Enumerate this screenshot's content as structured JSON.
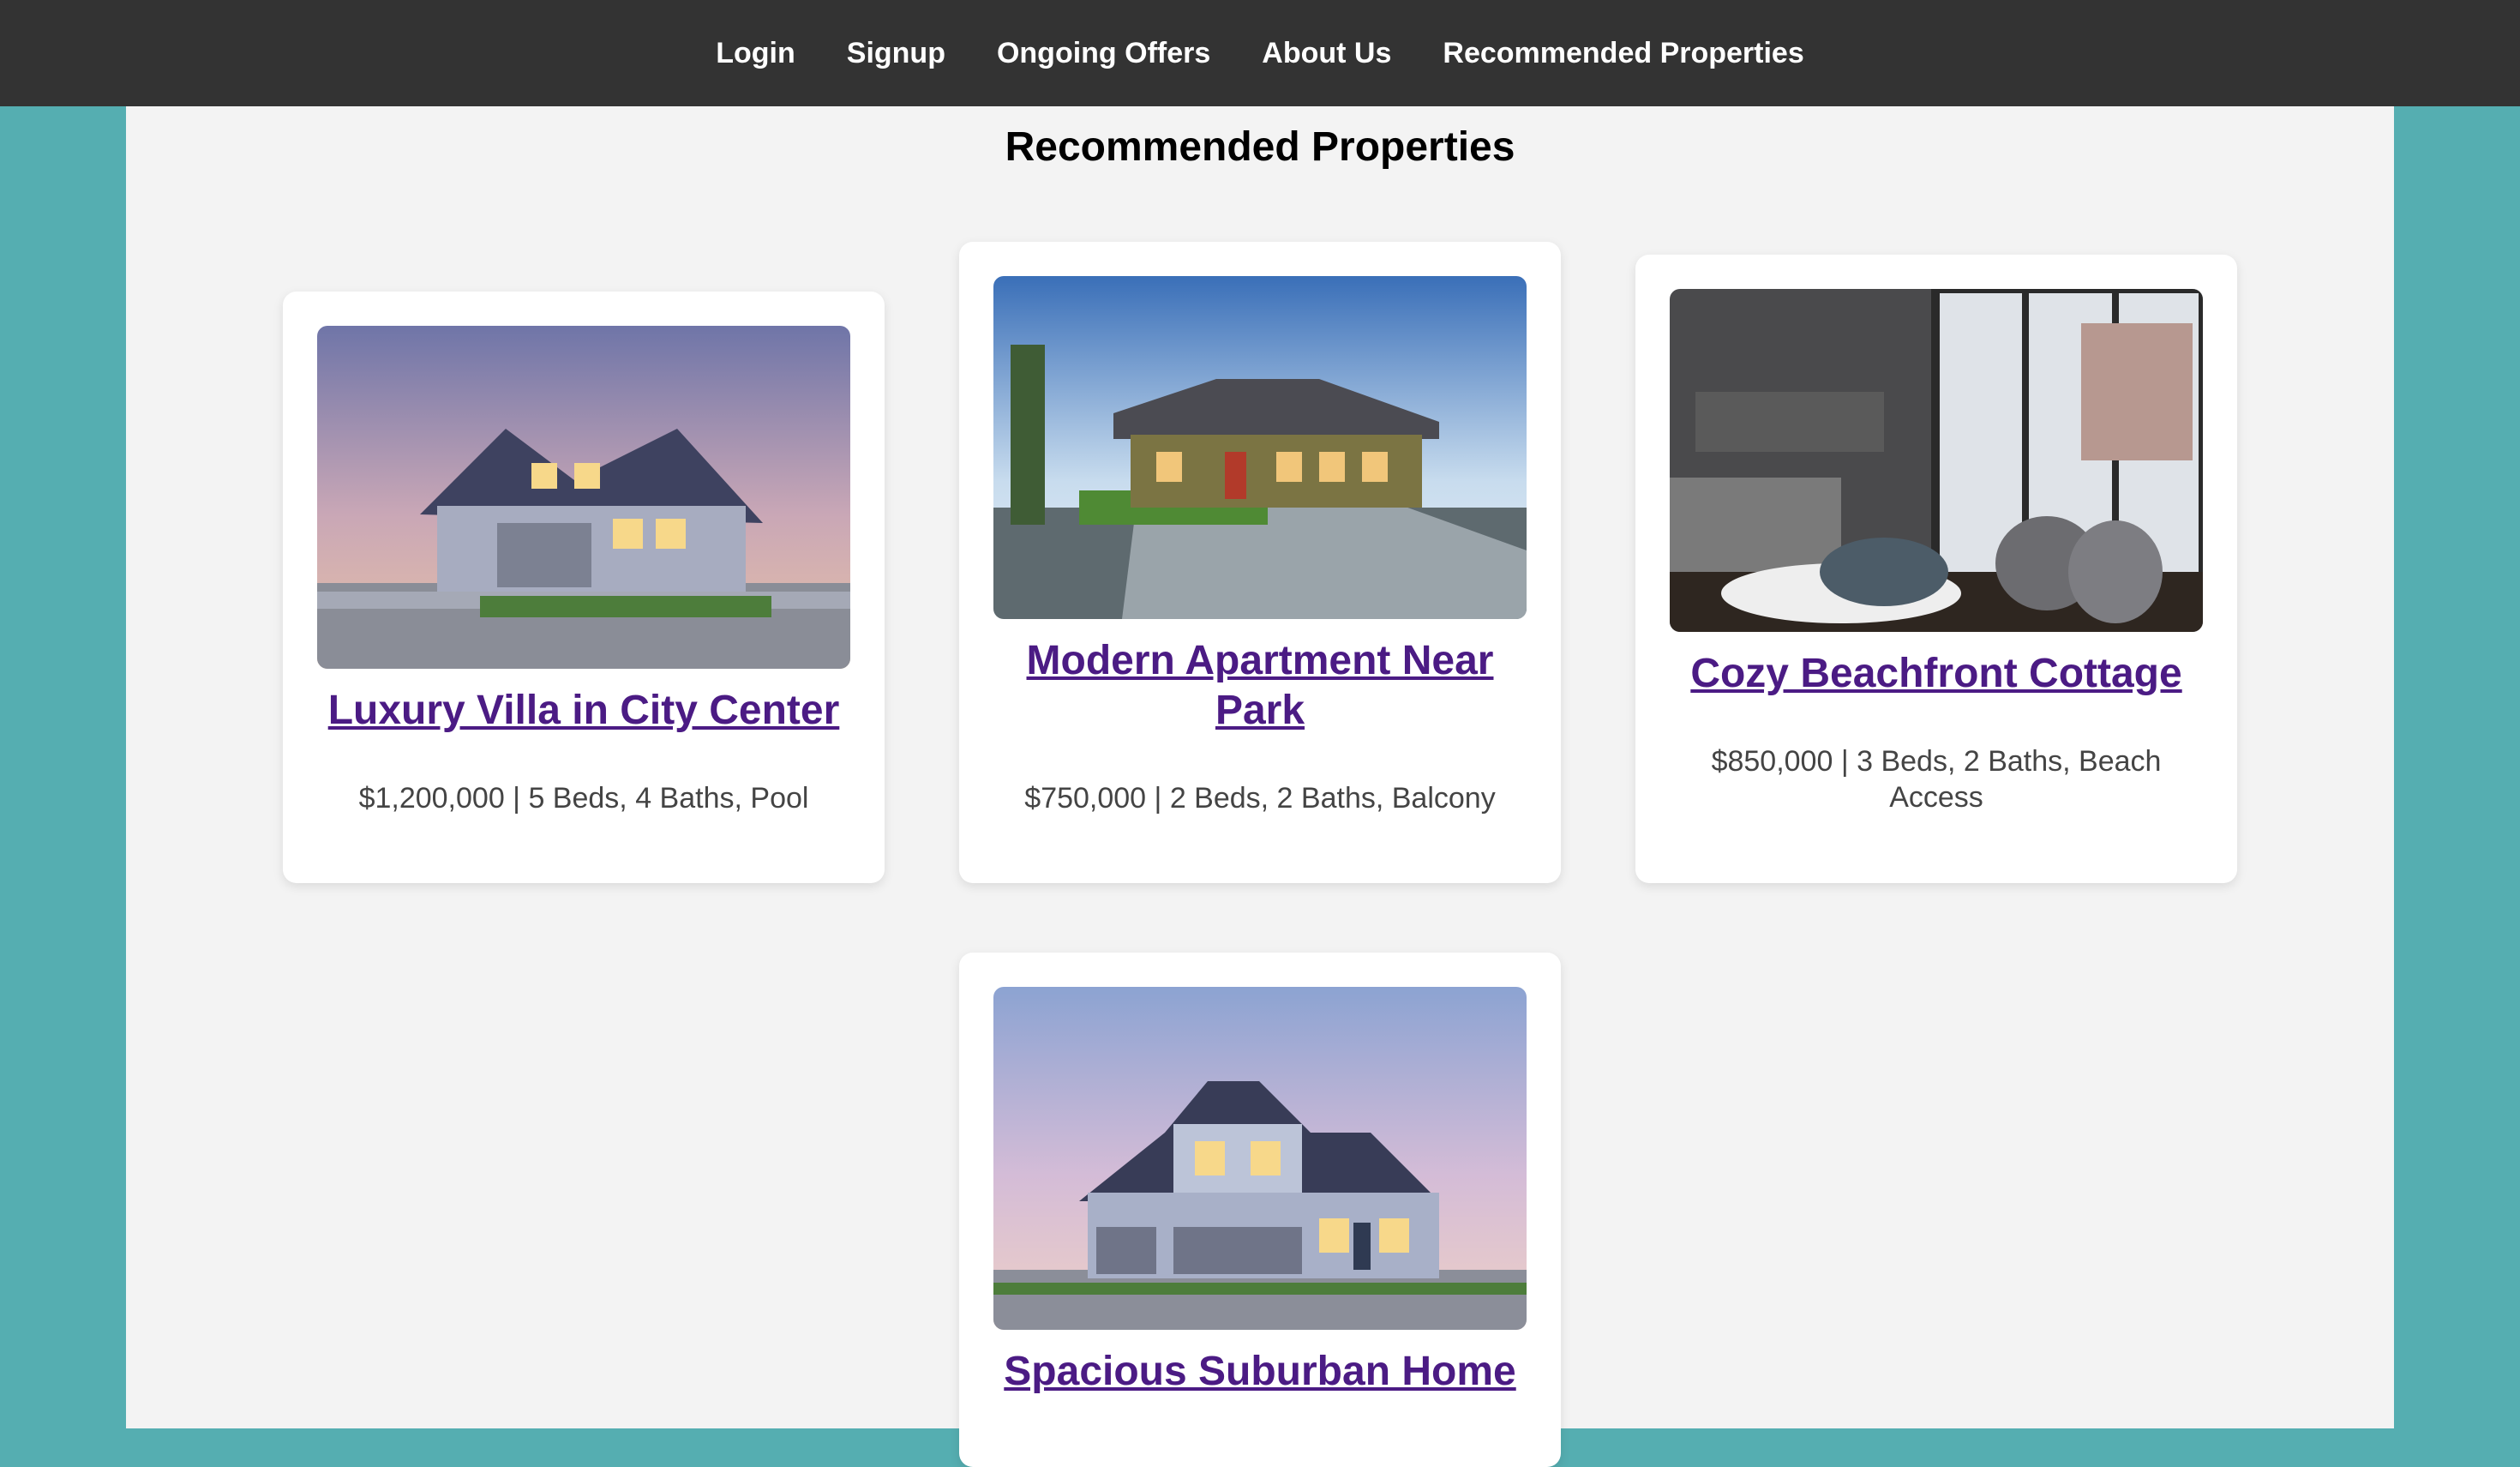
{
  "nav": {
    "items": [
      {
        "label": "Login"
      },
      {
        "label": "Signup"
      },
      {
        "label": "Ongoing Offers"
      },
      {
        "label": "About Us"
      },
      {
        "label": "Recommended Properties"
      }
    ]
  },
  "page": {
    "title": "Recommended Properties"
  },
  "properties": [
    {
      "title": "Luxury Villa in City Center",
      "details": "$1,200,000 | 5 Beds, 4 Baths, Pool"
    },
    {
      "title": "Modern Apartment Near Park",
      "details": "$750,000 | 2 Beds, 2 Baths, Balcony"
    },
    {
      "title": "Cozy Beachfront Cottage",
      "details": "$850,000 | 3 Beds, 2 Baths, Beach Access"
    },
    {
      "title": "Spacious Suburban Home",
      "details": ""
    }
  ],
  "colors": {
    "background": "#55aeb1",
    "nav_bg": "#333333",
    "content_bg": "#f3f3f3",
    "link": "#4b1b84"
  }
}
